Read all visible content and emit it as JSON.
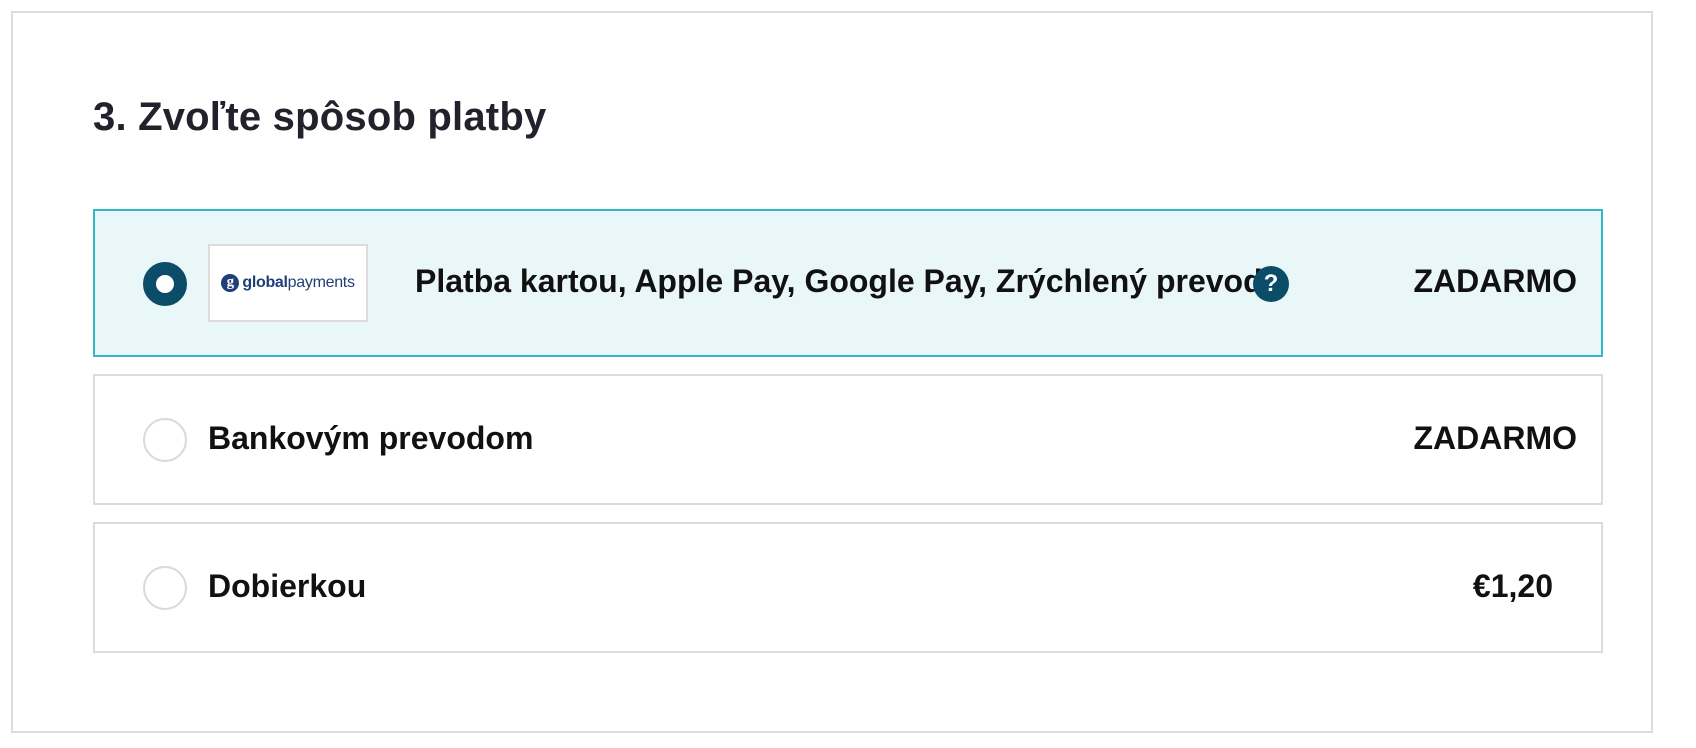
{
  "section": {
    "title": "3. Zvoľte spôsob platby"
  },
  "payment_options": [
    {
      "label": "Platba kartou, Apple Pay, Google Pay, Zrýchlený prevod",
      "price": "ZADARMO",
      "selected": true,
      "logo": {
        "mark": "g",
        "text_bold": "global",
        "text_regular": "payments"
      },
      "help_icon": "?"
    },
    {
      "label": "Bankovým prevodom",
      "price": "ZADARMO",
      "selected": false
    },
    {
      "label": "Dobierkou",
      "price": "€1,20",
      "selected": false
    }
  ],
  "colors": {
    "accent": "#0b4c68",
    "selected_border": "#33b8c9",
    "selected_background": "#e9f7f9",
    "border": "#dcdcdc",
    "logo_brand": "#1f3f78"
  }
}
